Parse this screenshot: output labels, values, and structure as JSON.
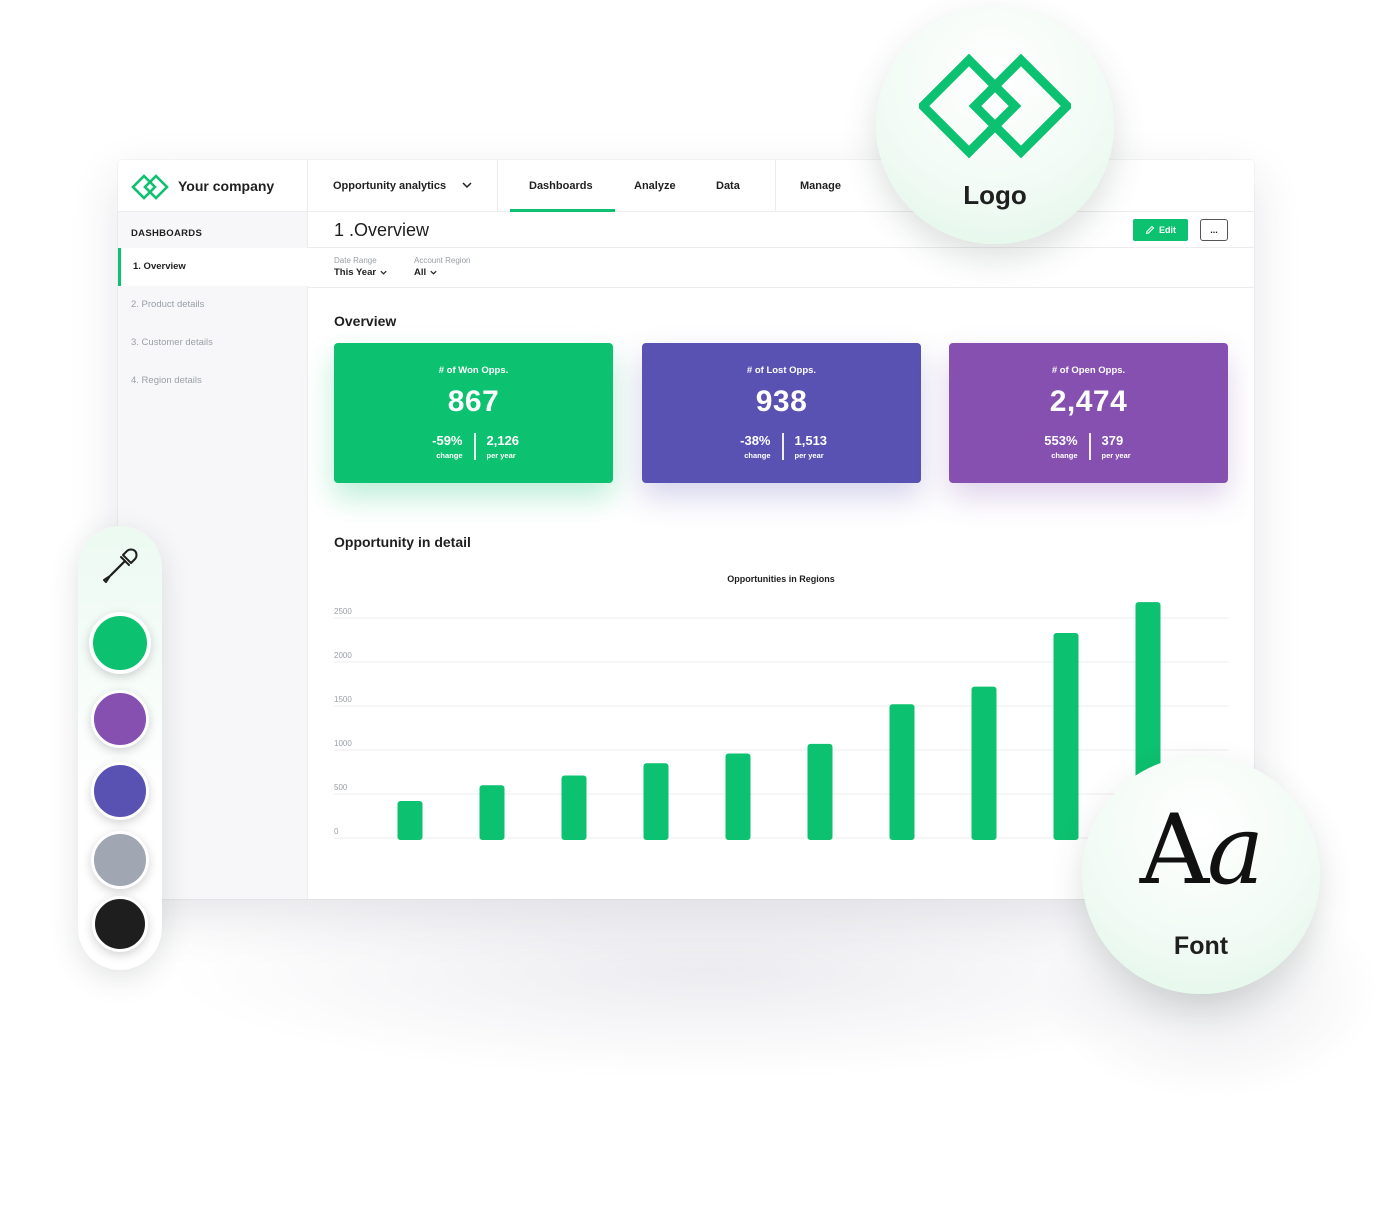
{
  "brand": {
    "name": "Your company"
  },
  "workspace": {
    "label": "Opportunity analytics"
  },
  "nav": {
    "tabs": [
      {
        "label": "Dashboards",
        "active": true
      },
      {
        "label": "Analyze"
      },
      {
        "label": "Data"
      },
      {
        "label": "Manage"
      }
    ]
  },
  "sidebar": {
    "heading": "DASHBOARDS",
    "items": [
      {
        "label": "1. Overview",
        "active": true
      },
      {
        "label": "2. Product details"
      },
      {
        "label": "3. Customer details"
      },
      {
        "label": "4. Region details"
      }
    ]
  },
  "page": {
    "title": "1 .Overview",
    "edit_label": "Edit",
    "more_label": "..."
  },
  "filters": [
    {
      "label": "Date Range",
      "value": "This Year"
    },
    {
      "label": "Account Region",
      "value": "All"
    }
  ],
  "sections": {
    "overview": "Overview",
    "detail": "Opportunity in detail"
  },
  "kpis": [
    {
      "title": "# of Won Opps.",
      "value": "867",
      "change": "-59%",
      "change_caption": "change",
      "per_year": "2,126",
      "per_year_caption": "per year",
      "color": "#0cc16f"
    },
    {
      "title": "# of Lost Opps.",
      "value": "938",
      "change": "-38%",
      "change_caption": "change",
      "per_year": "1,513",
      "per_year_caption": "per year",
      "color": "#5a52b3"
    },
    {
      "title": "# of Open Opps.",
      "value": "2,474",
      "change": "553%",
      "change_caption": "change",
      "per_year": "379",
      "per_year_caption": "per year",
      "color": "#8550b0"
    }
  ],
  "chart_data": {
    "type": "bar",
    "title": "Opportunities in Regions",
    "xlabel": "",
    "ylabel": "",
    "ylim": [
      0,
      2500
    ],
    "yticks": [
      0,
      500,
      1000,
      1500,
      2000,
      2500
    ],
    "grid": true,
    "values": [
      420,
      600,
      710,
      850,
      960,
      1070,
      1520,
      1720,
      2330,
      2680
    ],
    "color": "#0cc16f"
  },
  "palette": {
    "colors": [
      "#0cc16f",
      "#8550b0",
      "#5a52b3",
      "#a0a7b3",
      "#1e1e1e"
    ],
    "tool_icon": "eyedropper-icon"
  },
  "badges": {
    "logo_label": "Logo",
    "font_sample_upright": "A",
    "font_sample_italic": "a",
    "font_label": "Font"
  },
  "colors": {
    "accent": "#0cc16f"
  }
}
